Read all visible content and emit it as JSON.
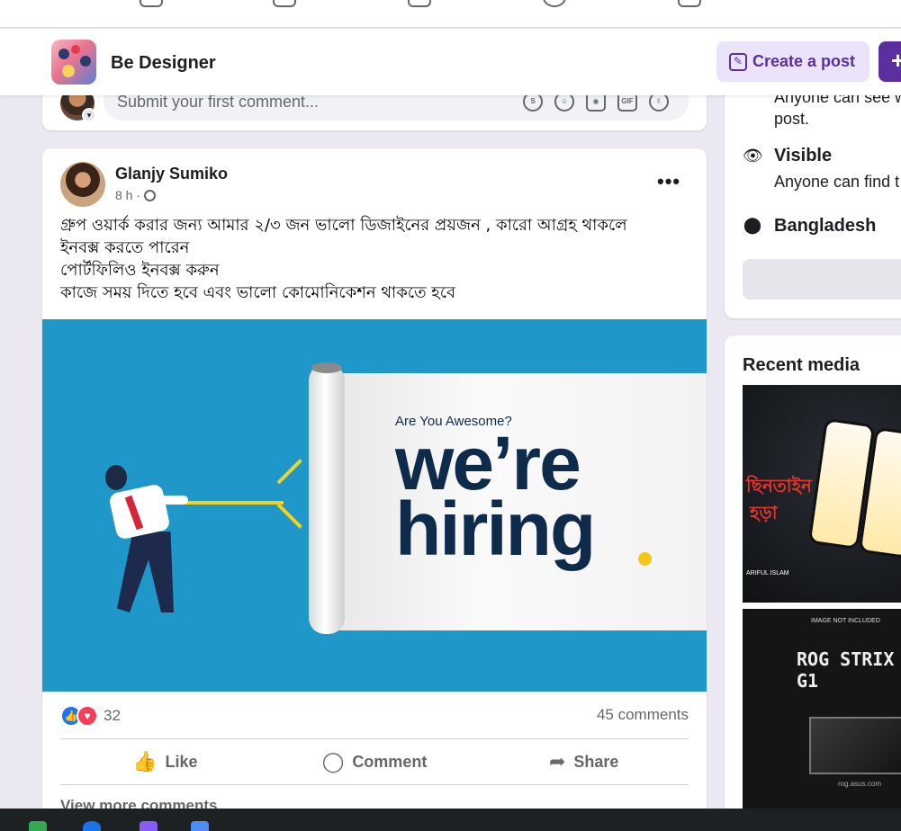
{
  "group": {
    "name": "Be Designer",
    "create_post_label": "Create a post",
    "plus_label": "+"
  },
  "comment_box": {
    "placeholder": "Submit your first comment..."
  },
  "post": {
    "author": "Glanjy Sumiko",
    "time": "8 h ·",
    "text_lines": [
      "গ্রুপ ওয়ার্ক করার জন্য আমার ২/৩ জন ভালো ডিজাইনের প্রয়জন , কারো আগ্রহ থাকলে",
      "ইনবক্স করতে পারেন",
      "পোর্টফিলিও ইনবক্স করুন",
      "কাজে সময় দিতে হবে এবং ভালো কোমোনিকেশন থাকতে হবে"
    ],
    "image": {
      "tagline": "Are You Awesome?",
      "headline_1": "we’re",
      "headline_2": "hiring"
    },
    "reaction_count": "32",
    "comment_count": "45 comments",
    "actions": {
      "like": "Like",
      "comment": "Comment",
      "share": "Share"
    },
    "view_more": "View more comments"
  },
  "about": {
    "privacy_text_1": "Anyone can see w",
    "privacy_text_2": "post.",
    "visible_title": "Visible",
    "visible_text": "Anyone can find t",
    "location": "Bangladesh"
  },
  "media": {
    "title": "Recent media",
    "item1": {
      "label_1": "ছিনতাইন",
      "label_2": "হড়া",
      "caption": "ARIFUL ISLAM"
    },
    "item2": {
      "caption_top": "IMAGE NOT INCLUDED",
      "title": "ROG STRIX G1",
      "caption_bottom": "rog.asus.com"
    }
  },
  "colors": {
    "accent": "#5b2f9f",
    "accent_light": "#ebe3fa",
    "like_blue": "#1877f2",
    "love_red": "#f33e58",
    "image_blue": "#1f98c9",
    "navy": "#0f2b4c"
  }
}
